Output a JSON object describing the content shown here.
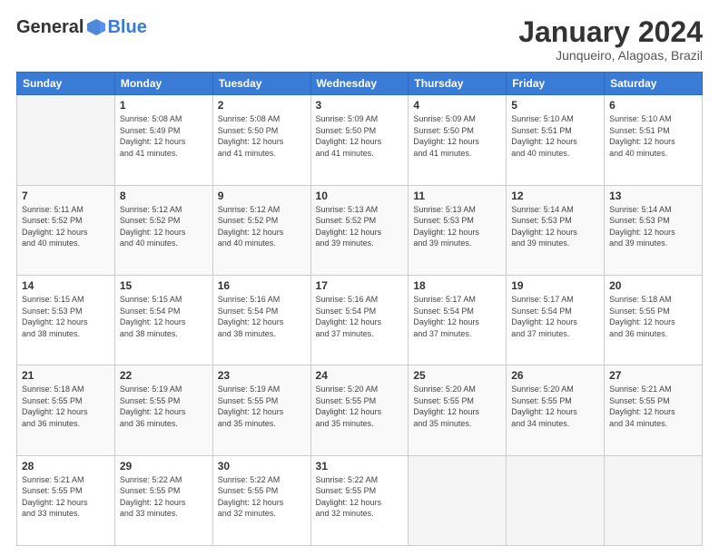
{
  "header": {
    "logo": {
      "general": "General",
      "blue": "Blue"
    },
    "title": "January 2024",
    "location": "Junqueiro, Alagoas, Brazil"
  },
  "weekdays": [
    "Sunday",
    "Monday",
    "Tuesday",
    "Wednesday",
    "Thursday",
    "Friday",
    "Saturday"
  ],
  "weeks": [
    [
      {
        "day": "",
        "info": ""
      },
      {
        "day": "1",
        "info": "Sunrise: 5:08 AM\nSunset: 5:49 PM\nDaylight: 12 hours\nand 41 minutes."
      },
      {
        "day": "2",
        "info": "Sunrise: 5:08 AM\nSunset: 5:50 PM\nDaylight: 12 hours\nand 41 minutes."
      },
      {
        "day": "3",
        "info": "Sunrise: 5:09 AM\nSunset: 5:50 PM\nDaylight: 12 hours\nand 41 minutes."
      },
      {
        "day": "4",
        "info": "Sunrise: 5:09 AM\nSunset: 5:50 PM\nDaylight: 12 hours\nand 41 minutes."
      },
      {
        "day": "5",
        "info": "Sunrise: 5:10 AM\nSunset: 5:51 PM\nDaylight: 12 hours\nand 40 minutes."
      },
      {
        "day": "6",
        "info": "Sunrise: 5:10 AM\nSunset: 5:51 PM\nDaylight: 12 hours\nand 40 minutes."
      }
    ],
    [
      {
        "day": "7",
        "info": "Sunrise: 5:11 AM\nSunset: 5:52 PM\nDaylight: 12 hours\nand 40 minutes."
      },
      {
        "day": "8",
        "info": "Sunrise: 5:12 AM\nSunset: 5:52 PM\nDaylight: 12 hours\nand 40 minutes."
      },
      {
        "day": "9",
        "info": "Sunrise: 5:12 AM\nSunset: 5:52 PM\nDaylight: 12 hours\nand 40 minutes."
      },
      {
        "day": "10",
        "info": "Sunrise: 5:13 AM\nSunset: 5:52 PM\nDaylight: 12 hours\nand 39 minutes."
      },
      {
        "day": "11",
        "info": "Sunrise: 5:13 AM\nSunset: 5:53 PM\nDaylight: 12 hours\nand 39 minutes."
      },
      {
        "day": "12",
        "info": "Sunrise: 5:14 AM\nSunset: 5:53 PM\nDaylight: 12 hours\nand 39 minutes."
      },
      {
        "day": "13",
        "info": "Sunrise: 5:14 AM\nSunset: 5:53 PM\nDaylight: 12 hours\nand 39 minutes."
      }
    ],
    [
      {
        "day": "14",
        "info": "Sunrise: 5:15 AM\nSunset: 5:53 PM\nDaylight: 12 hours\nand 38 minutes."
      },
      {
        "day": "15",
        "info": "Sunrise: 5:15 AM\nSunset: 5:54 PM\nDaylight: 12 hours\nand 38 minutes."
      },
      {
        "day": "16",
        "info": "Sunrise: 5:16 AM\nSunset: 5:54 PM\nDaylight: 12 hours\nand 38 minutes."
      },
      {
        "day": "17",
        "info": "Sunrise: 5:16 AM\nSunset: 5:54 PM\nDaylight: 12 hours\nand 37 minutes."
      },
      {
        "day": "18",
        "info": "Sunrise: 5:17 AM\nSunset: 5:54 PM\nDaylight: 12 hours\nand 37 minutes."
      },
      {
        "day": "19",
        "info": "Sunrise: 5:17 AM\nSunset: 5:54 PM\nDaylight: 12 hours\nand 37 minutes."
      },
      {
        "day": "20",
        "info": "Sunrise: 5:18 AM\nSunset: 5:55 PM\nDaylight: 12 hours\nand 36 minutes."
      }
    ],
    [
      {
        "day": "21",
        "info": "Sunrise: 5:18 AM\nSunset: 5:55 PM\nDaylight: 12 hours\nand 36 minutes."
      },
      {
        "day": "22",
        "info": "Sunrise: 5:19 AM\nSunset: 5:55 PM\nDaylight: 12 hours\nand 36 minutes."
      },
      {
        "day": "23",
        "info": "Sunrise: 5:19 AM\nSunset: 5:55 PM\nDaylight: 12 hours\nand 35 minutes."
      },
      {
        "day": "24",
        "info": "Sunrise: 5:20 AM\nSunset: 5:55 PM\nDaylight: 12 hours\nand 35 minutes."
      },
      {
        "day": "25",
        "info": "Sunrise: 5:20 AM\nSunset: 5:55 PM\nDaylight: 12 hours\nand 35 minutes."
      },
      {
        "day": "26",
        "info": "Sunrise: 5:20 AM\nSunset: 5:55 PM\nDaylight: 12 hours\nand 34 minutes."
      },
      {
        "day": "27",
        "info": "Sunrise: 5:21 AM\nSunset: 5:55 PM\nDaylight: 12 hours\nand 34 minutes."
      }
    ],
    [
      {
        "day": "28",
        "info": "Sunrise: 5:21 AM\nSunset: 5:55 PM\nDaylight: 12 hours\nand 33 minutes."
      },
      {
        "day": "29",
        "info": "Sunrise: 5:22 AM\nSunset: 5:55 PM\nDaylight: 12 hours\nand 33 minutes."
      },
      {
        "day": "30",
        "info": "Sunrise: 5:22 AM\nSunset: 5:55 PM\nDaylight: 12 hours\nand 32 minutes."
      },
      {
        "day": "31",
        "info": "Sunrise: 5:22 AM\nSunset: 5:55 PM\nDaylight: 12 hours\nand 32 minutes."
      },
      {
        "day": "",
        "info": ""
      },
      {
        "day": "",
        "info": ""
      },
      {
        "day": "",
        "info": ""
      }
    ]
  ]
}
